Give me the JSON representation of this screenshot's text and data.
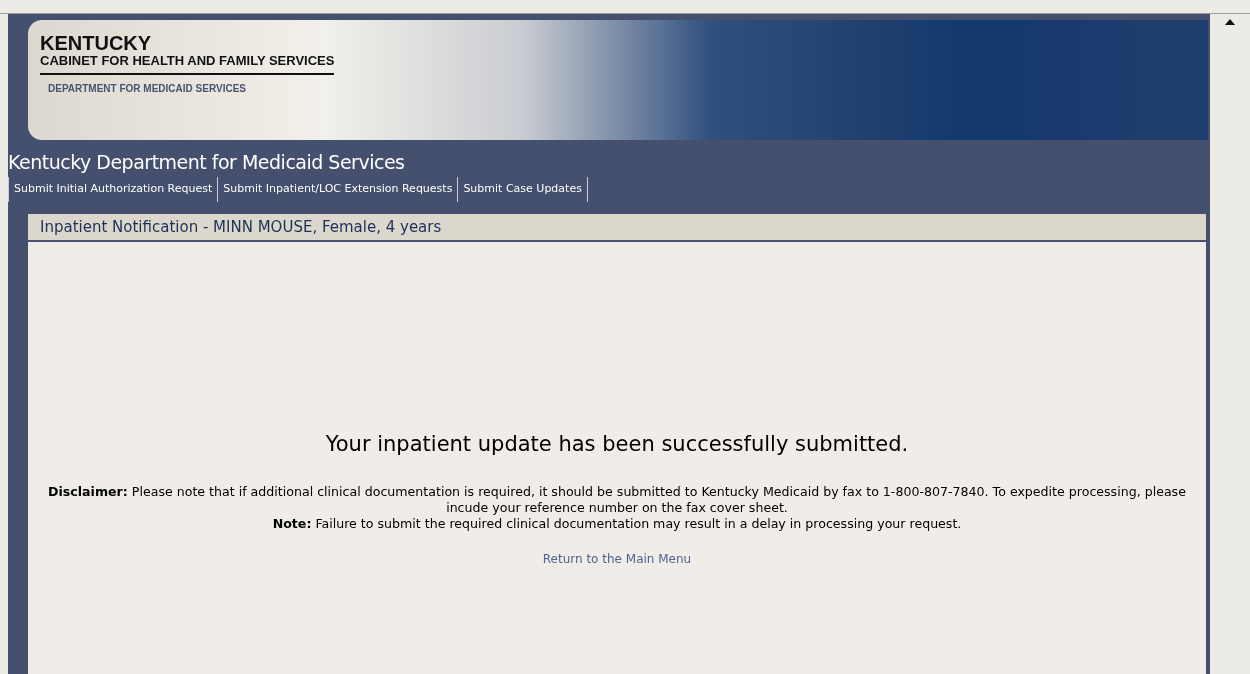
{
  "banner": {
    "state": "KENTUCKY",
    "cabinet": "CABINET FOR HEALTH AND FAMILY SERVICES",
    "department": "DEPARTMENT FOR MEDICAID SERVICES"
  },
  "site_title": "Kentucky Department for Medicaid Services",
  "nav": [
    "Submit Initial Authorization Request",
    "Submit Inpatient/LOC Extension Requests",
    "Submit Case Updates"
  ],
  "panel": {
    "title": "Inpatient Notification - MINN MOUSE, Female, 4 years",
    "message": "Your inpatient update has been successfully submitted.",
    "disclaimer": "**Disclaimer:** Please note that if additional clinical documentation is required, it should be submitted to Kentucky Medicaid by fax to 1-800-807-7840. To expedite processing, please incude your reference number on the fax cover sheet.",
    "note": "**Note:** Failure to submit the required clinical documentation may result in a delay in processing your request.",
    "link": "Return to the Main Menu"
  }
}
